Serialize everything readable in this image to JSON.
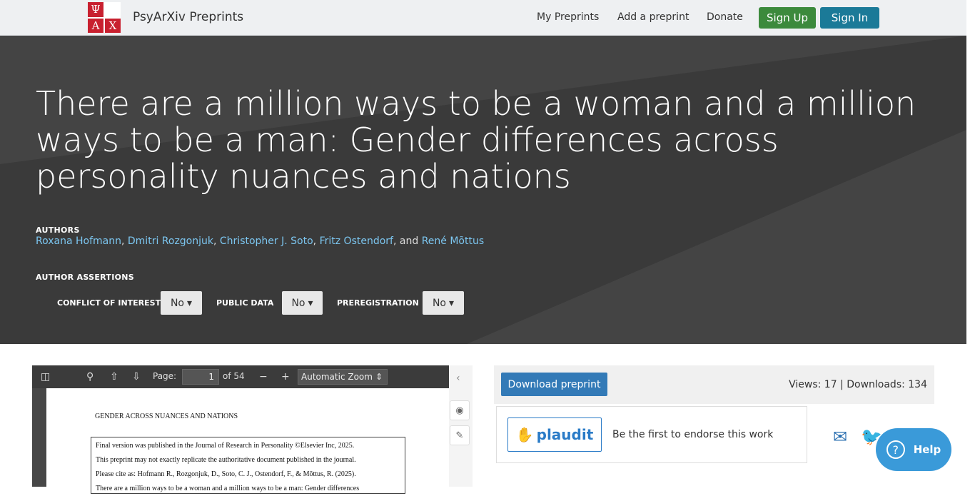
{
  "header": {
    "logo_letters": [
      "Ψ",
      "",
      "Α",
      "Χ"
    ],
    "brand": "PsyArXiv Preprints",
    "nav": [
      "My Preprints",
      "Add a preprint",
      "Donate"
    ],
    "sign_up": "Sign Up",
    "sign_in": "Sign In"
  },
  "hero": {
    "title": "There are a million ways to be a woman and a million ways to be a man: Gender differences across personality nuances and nations",
    "authors_heading": "AUTHORS",
    "authors": [
      "Roxana Hofmann",
      "Dmitri Rozgonjuk",
      "Christopher J. Soto",
      "Fritz Ostendorf",
      "René Mõttus"
    ],
    "authors_and": ", and ",
    "assertions_heading": "AUTHOR ASSERTIONS",
    "assertions": [
      {
        "label": "CONFLICT OF INTEREST",
        "value": "No"
      },
      {
        "label": "PUBLIC DATA",
        "value": "No"
      },
      {
        "label": "PREREGISTRATION",
        "value": "No"
      }
    ]
  },
  "pdf_viewer": {
    "page_label": "Page:",
    "page_value": "1",
    "page_total": "of 54",
    "zoom": "Automatic Zoom",
    "doc_header": "GENDER ACROSS NUANCES AND NATIONS",
    "doc_box_lines": [
      "Final version was published in the Journal of Research in Personality ©Elsevier Inc, 2025.",
      "This preprint may not exactly replicate the authoritative document published in the journal.",
      "Please cite as:  Hofmann R., Rozgonjuk, D., Soto, C. J., Ostendorf, F., & Mõttus, R. (2025).",
      "There are a million ways to be a woman and a million ways to be a man: Gender differences"
    ]
  },
  "download": {
    "button": "Download preprint",
    "stats": "Views: 17 | Downloads: 134"
  },
  "plaudit": {
    "brand": "plaudit",
    "message": "Be the first to endorse this work"
  },
  "help": {
    "label": "Help"
  },
  "colors": {
    "accent_green": "#3c8a3c",
    "accent_teal": "#1b7a98",
    "link_blue": "#7cc6f0",
    "primary_blue": "#337ab7"
  }
}
